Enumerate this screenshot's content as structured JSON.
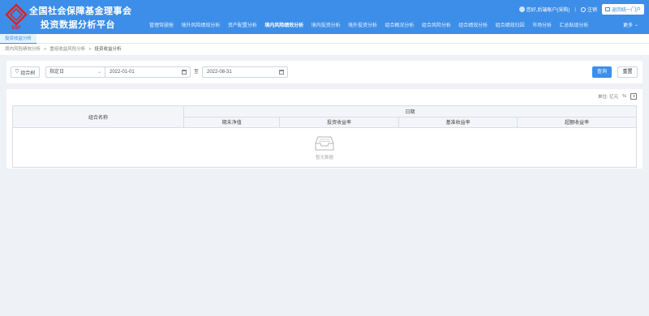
{
  "header": {
    "org_name": "全国社会保障基金理事会",
    "platform_name": "投资数据分析平台",
    "logo_text": "SSF",
    "user_greeting": "您好,后端账户(采购)",
    "logout": "注销",
    "portal_button": "返回统一门户",
    "more": "更多"
  },
  "nav": [
    "管理驾驶舱",
    "境外风险绩效分析",
    "资产配置分析",
    "境内风险绩效分析",
    "境内投资分析",
    "境外投资分析",
    "组合概况分析",
    "组合风险分析",
    "组合绩效分析",
    "组合绩效归因",
    "市场分析",
    "汇总贴现分析"
  ],
  "tabs": {
    "active": "投资收益分析"
  },
  "breadcrumb": [
    "境内风险绩效分析",
    "重组收益风险分析",
    "投资收益分析"
  ],
  "filters": {
    "group_button": "组合树",
    "date_type": "指定日",
    "start_date": "2022-01-01",
    "to": "至",
    "end_date": "2022-08-31",
    "query": "查询",
    "reset": "重置"
  },
  "table": {
    "unit": "单位: 亿元",
    "percent": "%",
    "group_header": "组合名称",
    "date_header": "日期",
    "columns": [
      "期末净值",
      "投资收益率",
      "基准收益率",
      "超额收益率"
    ],
    "empty_text": "暂无数据"
  }
}
